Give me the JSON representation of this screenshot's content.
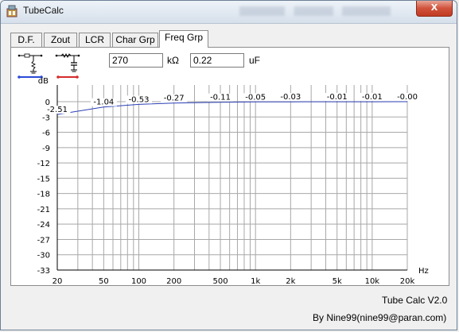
{
  "window": {
    "title": "TubeCalc",
    "close_label": "X"
  },
  "tabs": [
    {
      "label": "D.F.",
      "active": false
    },
    {
      "label": "Zout",
      "active": false
    },
    {
      "label": "LCR",
      "active": false
    },
    {
      "label": "Char Grp",
      "active": false
    },
    {
      "label": "Freq Grp",
      "active": true
    }
  ],
  "controls": {
    "resistance_value": "270",
    "resistance_unit": "kΩ",
    "capacitance_value": "0.22",
    "capacitance_unit": "uF",
    "filter1_color": "#2b4ad6",
    "filter2_color": "#d62b2b"
  },
  "footer": {
    "version": "Tube Calc V2.0",
    "author": "By Nine99(nine99@paran.com)"
  },
  "chart_data": {
    "type": "line",
    "xscale": "log",
    "xlabel": "Hz",
    "ylabel": "dB",
    "xlim": [
      20,
      20000
    ],
    "ylim": [
      -33,
      0
    ],
    "x_tick_labels": [
      "20",
      "50",
      "100",
      "200",
      "500",
      "1k",
      "2k",
      "5k",
      "10k",
      "20k"
    ],
    "x_tick_values": [
      20,
      50,
      100,
      200,
      500,
      1000,
      2000,
      5000,
      10000,
      20000
    ],
    "y_ticks": [
      0,
      -3,
      -6,
      -9,
      -12,
      -15,
      -18,
      -21,
      -24,
      -27,
      -30,
      -33
    ],
    "grid": true,
    "line_color": "#2b3fb5",
    "series": [
      {
        "x": [
          20,
          50,
          100,
          200,
          500,
          1000,
          2000,
          5000,
          10000,
          20000
        ],
        "y": [
          -2.51,
          -1.04,
          -0.53,
          -0.27,
          -0.11,
          -0.05,
          -0.03,
          -0.01,
          -0.01,
          -0.0
        ]
      }
    ],
    "point_labels": [
      "-2.51",
      "-1.04",
      "-0.53",
      "-0.27",
      "-0.11",
      "-0.05",
      "-0.03",
      "-0.01",
      "-0.01",
      "-0.00"
    ]
  }
}
